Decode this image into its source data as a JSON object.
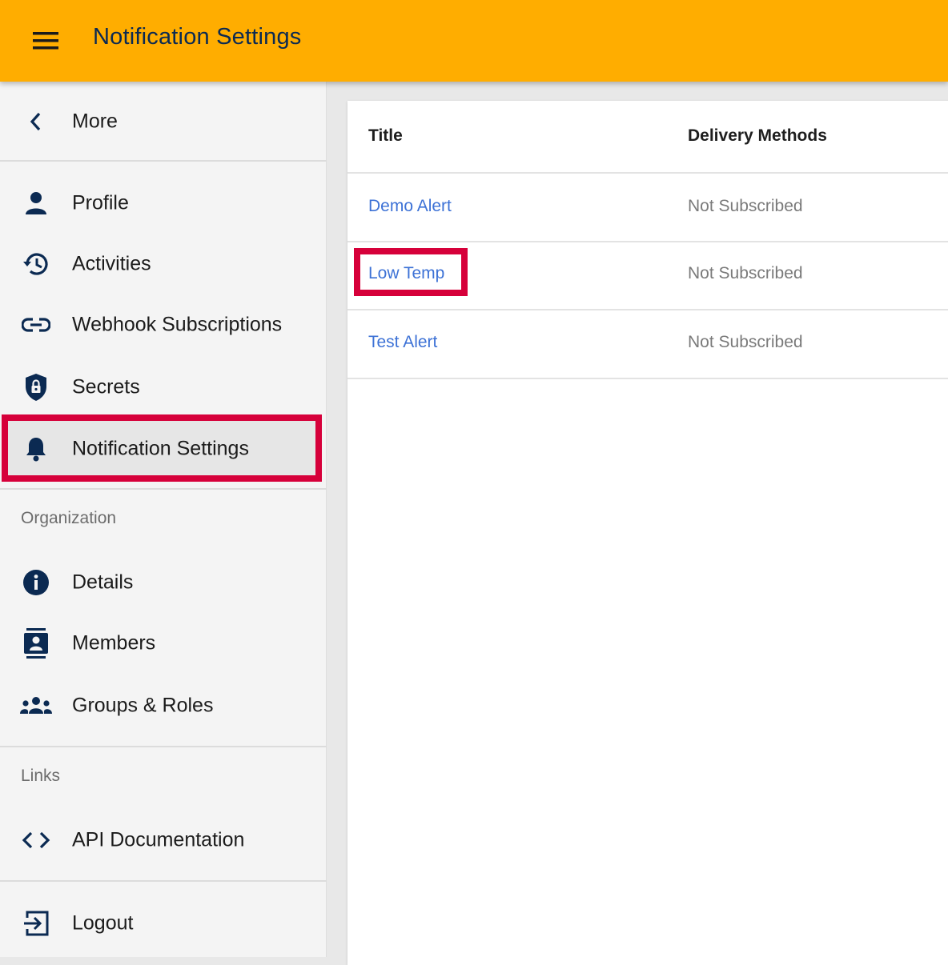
{
  "appbar": {
    "title": "Notification Settings",
    "menu_icon": "hamburger-menu-icon",
    "color": "#ffad00",
    "title_color": "#0b2a52"
  },
  "sidebar": {
    "back": {
      "label": "More",
      "icon": "chevron-left-icon"
    },
    "items": [
      {
        "label": "Profile",
        "icon": "person-icon"
      },
      {
        "label": "Activities",
        "icon": "history-icon"
      },
      {
        "label": "Webhook Subscriptions",
        "icon": "link-icon"
      },
      {
        "label": "Secrets",
        "icon": "shield-lock-icon"
      },
      {
        "label": "Notification Settings",
        "icon": "bell-icon",
        "active": true
      }
    ],
    "organization": {
      "heading": "Organization",
      "items": [
        {
          "label": "Details",
          "icon": "info-icon"
        },
        {
          "label": "Members",
          "icon": "contact-card-icon"
        },
        {
          "label": "Groups & Roles",
          "icon": "groups-icon"
        }
      ]
    },
    "links": {
      "heading": "Links",
      "items": [
        {
          "label": "API Documentation",
          "icon": "code-icon"
        }
      ]
    },
    "logout": {
      "label": "Logout",
      "icon": "logout-icon"
    }
  },
  "table": {
    "columns": [
      "Title",
      "Delivery Methods"
    ],
    "rows": [
      {
        "title": "Demo Alert",
        "delivery": "Not Subscribed"
      },
      {
        "title": "Low Temp",
        "delivery": "Not Subscribed",
        "highlighted": true
      },
      {
        "title": "Test Alert",
        "delivery": "Not Subscribed"
      }
    ]
  },
  "colors": {
    "link": "#3d72d6",
    "highlight": "#d6003a",
    "icon": "#0b2a52"
  }
}
